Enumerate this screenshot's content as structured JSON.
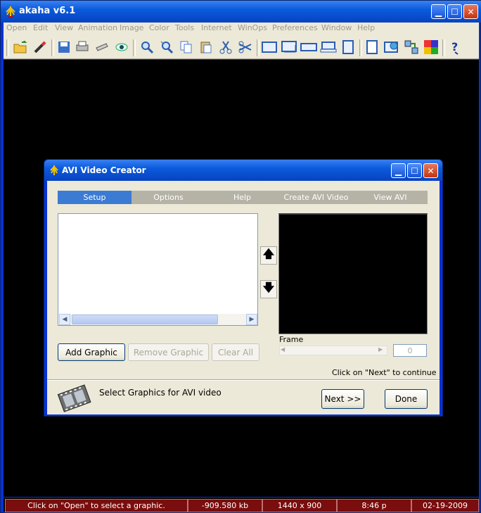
{
  "window": {
    "title": "akaha v6.1"
  },
  "menu": [
    "Open",
    "Edit",
    "View",
    "Animation",
    "Image",
    "Color",
    "Tools",
    "Internet",
    "WinOps",
    "Preferences",
    "Window",
    "Help"
  ],
  "toolbar_icons": [
    "open-folder-icon",
    "wand-icon",
    "save-icon",
    "print-icon",
    "scanner-icon",
    "eye-icon",
    "zoom-icon",
    "zoom-in-icon",
    "copy-icon",
    "paste-icon",
    "cut-icon",
    "scissors-icon",
    "window-layout-1-icon",
    "window-layout-2-icon",
    "window-layout-3-icon",
    "window-layout-4-icon",
    "window-layout-5-icon",
    "window-single-icon",
    "web-icon",
    "network-icon",
    "puzzle-icon",
    "help-icon"
  ],
  "dialog": {
    "title": "AVI Video Creator",
    "tabs": [
      "Setup",
      "Options",
      "Help",
      "Create AVI Video",
      "View AVI"
    ],
    "active_tab": "Setup",
    "buttons": {
      "add": "Add Graphic",
      "remove": "Remove Graphic",
      "clear": "Clear All",
      "next": "Next >>",
      "done": "Done"
    },
    "frame_label": "Frame",
    "frame_value": "0",
    "hint": "Click on \"Next\" to continue",
    "message": "Select Graphics for AVI video"
  },
  "status": {
    "message": "Click on \"Open\" to select a graphic.",
    "memory": "-909.580 kb",
    "resolution": "1440 x 900",
    "time": "8:46 p",
    "date": "02-19-2009"
  },
  "colors": {
    "title_blue": "#0a5bdc",
    "status_red": "#7a0d0d",
    "tab_active": "#3b7bd4"
  }
}
